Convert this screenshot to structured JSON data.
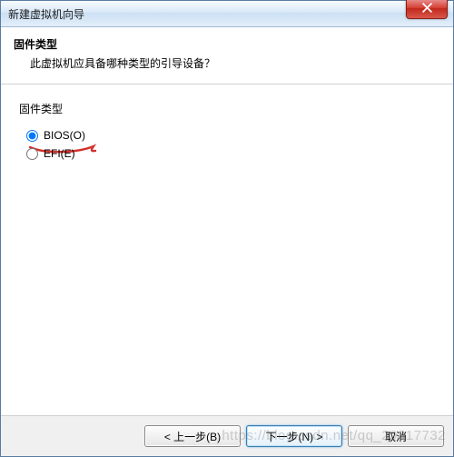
{
  "window": {
    "title": "新建虚拟机向导"
  },
  "header": {
    "title": "固件类型",
    "subtitle": "此虚拟机应具备哪种类型的引导设备？"
  },
  "group": {
    "label": "固件类型",
    "options": [
      {
        "label": "BIOS(O)",
        "selected": true
      },
      {
        "label": "EFI(E)",
        "selected": false
      }
    ]
  },
  "buttons": {
    "back": "< 上一步(B)",
    "next": "下一步(N) >",
    "cancel": "取消"
  },
  "watermark": "https://blog.csdn.net/qq_29817732"
}
